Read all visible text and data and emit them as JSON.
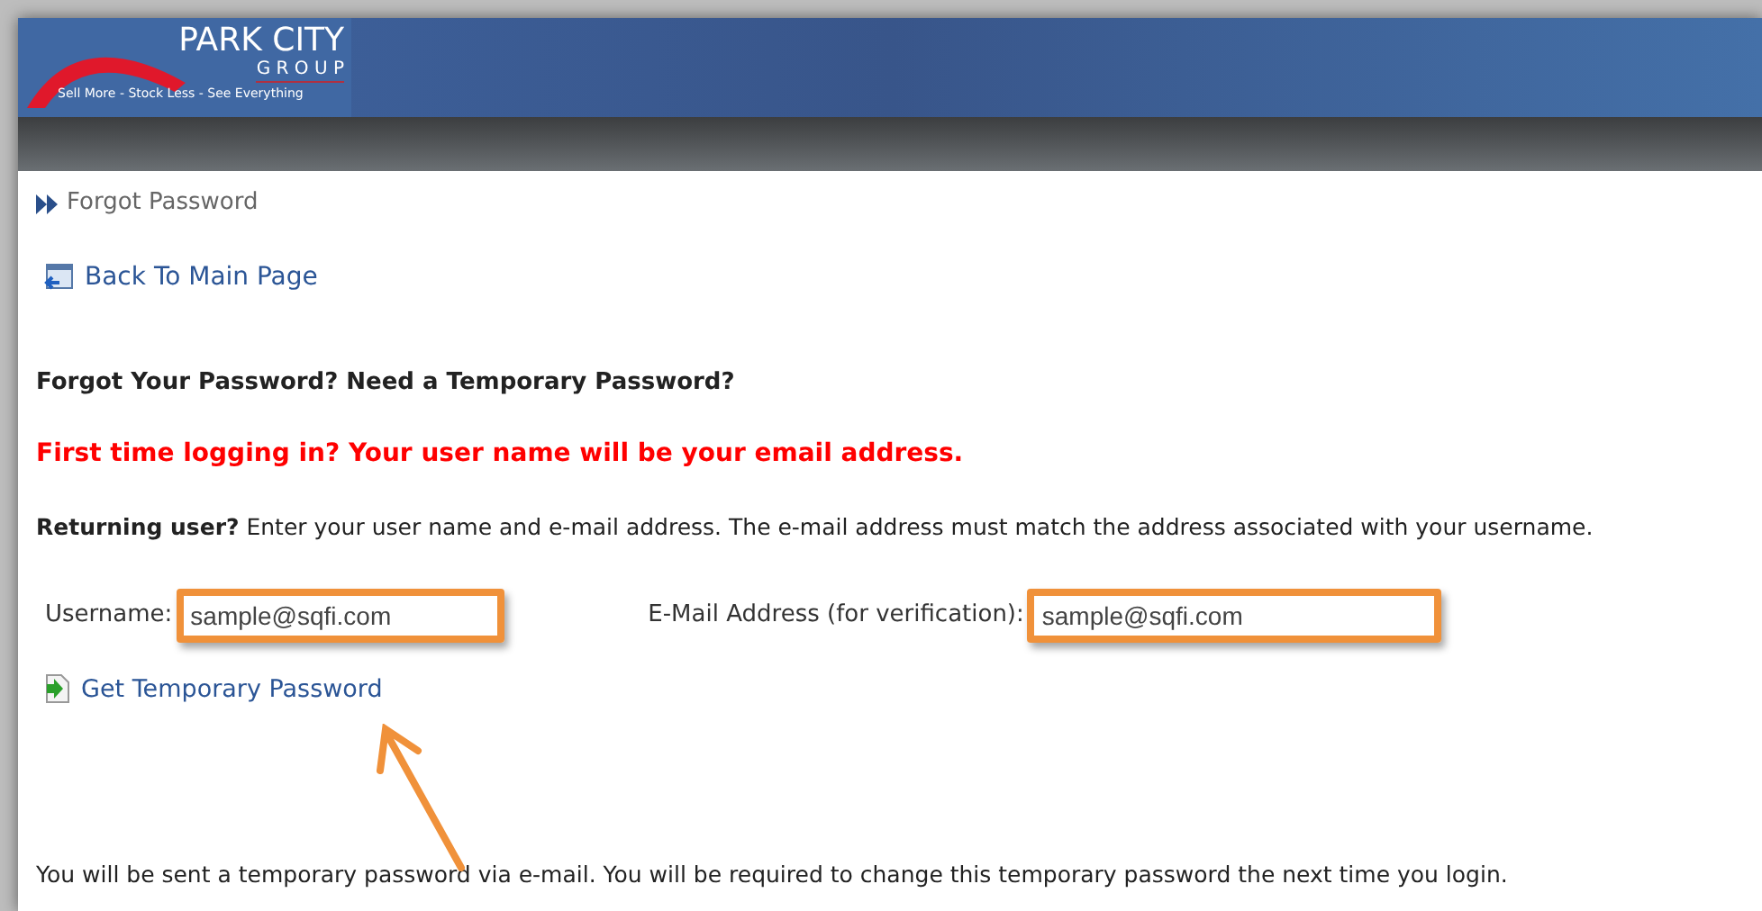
{
  "logo": {
    "name": "PARK CITY",
    "sub": "G R O U P",
    "tagline": "Sell More - Stock Less - See Everything"
  },
  "breadcrumb": "Forgot Password",
  "back_link": "Back To Main Page",
  "heading": "Forgot Your Password? Need a Temporary Password?",
  "notice": "First time logging in? Your user name will be your email address.",
  "instructions": "**Returning user?** Enter your user name and e-mail address. The e-mail address must match the address associated with your username.",
  "fields": [
    {
      "label": "Username:",
      "value": "sample@sqfi.com"
    },
    {
      "label": "E-Mail Address (for verification):",
      "value": "sample@sqfi.com"
    }
  ],
  "submit_link": "Get Temporary Password",
  "footer_note": "You will be sent a temporary password via e-mail. You will be required to change this temporary password the next time you login."
}
